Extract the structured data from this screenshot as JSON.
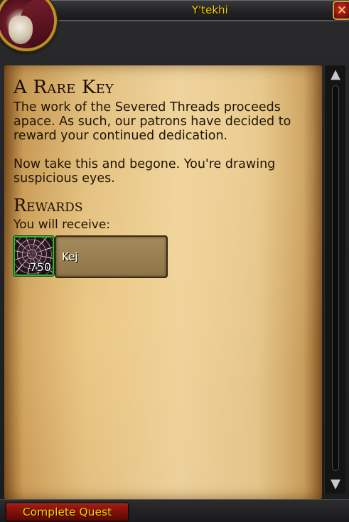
{
  "window": {
    "title": "Y'tekhi",
    "close_label": "✕",
    "accent_color": "#ffd100"
  },
  "quest": {
    "title": "A Rare Key",
    "paragraph1": "The work of the Severed Threads proceeds apace. As such, our patrons have decided to reward your continued dedication.",
    "paragraph2": "Now take this and begone. You're drawing suspicious eyes."
  },
  "rewards": {
    "heading": "Rewards",
    "receive_label": "You will receive:",
    "items": [
      {
        "name": "Kej",
        "count": "750",
        "icon": "web-icon",
        "border_color": "#2fb52f"
      }
    ]
  },
  "scrollbar": {
    "up_icon": "▲",
    "down_icon": "▼"
  },
  "footer": {
    "complete_label": "Complete Quest"
  }
}
